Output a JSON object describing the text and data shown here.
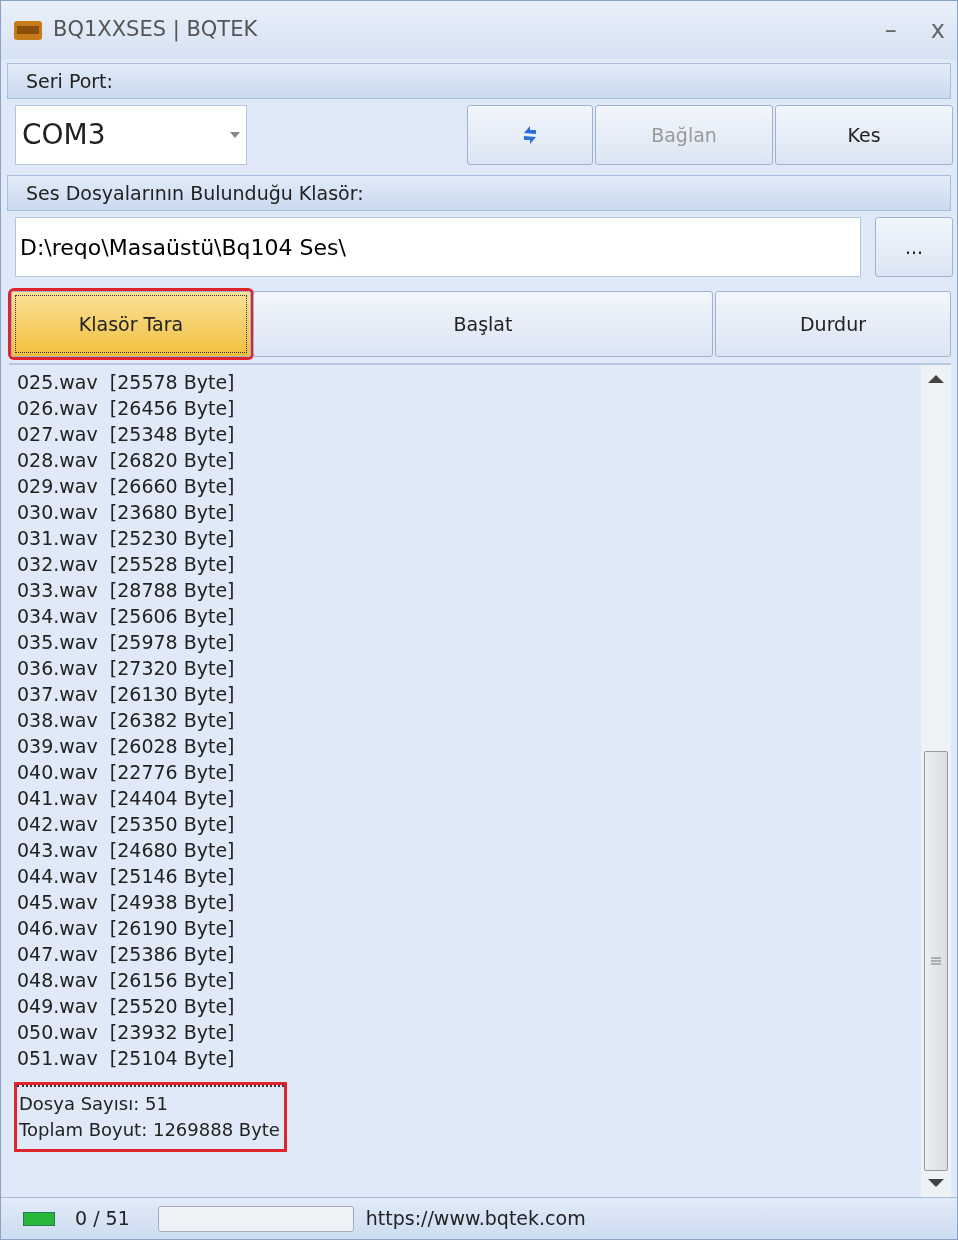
{
  "window": {
    "title": "BQ1XXSES | BQTEK",
    "controls": [
      "–",
      "x"
    ]
  },
  "serial": {
    "header": "Seri Port:",
    "port": "COM3",
    "buttons": [
      {
        "kind": "refresh",
        "disabled": false
      },
      {
        "kind": "text",
        "label": "Bağlan",
        "disabled": true
      },
      {
        "kind": "text",
        "label": "Kes",
        "disabled": false
      }
    ]
  },
  "folder": {
    "header": "Ses Dosyalarının Bulunduğu Klasör:",
    "path": "D:\\reqo\\Masaüstü\\Bq104 Ses\\",
    "browse": "..."
  },
  "actions": [
    {
      "label": "Klasör Tara",
      "focused": true,
      "highlighted": true
    },
    {
      "label": "Başlat",
      "focused": false,
      "highlighted": false
    },
    {
      "label": "Durdur",
      "focused": false,
      "highlighted": false
    }
  ],
  "log": {
    "lines": [
      "025.wav  [25578 Byte]",
      "026.wav  [26456 Byte]",
      "027.wav  [25348 Byte]",
      "028.wav  [26820 Byte]",
      "029.wav  [26660 Byte]",
      "030.wav  [23680 Byte]",
      "031.wav  [25230 Byte]",
      "032.wav  [25528 Byte]",
      "033.wav  [28788 Byte]",
      "034.wav  [25606 Byte]",
      "035.wav  [25978 Byte]",
      "036.wav  [27320 Byte]",
      "037.wav  [26130 Byte]",
      "038.wav  [26382 Byte]",
      "039.wav  [26028 Byte]",
      "040.wav  [22776 Byte]",
      "041.wav  [24404 Byte]",
      "042.wav  [25350 Byte]",
      "043.wav  [24680 Byte]",
      "044.wav  [25146 Byte]",
      "045.wav  [24938 Byte]",
      "046.wav  [26190 Byte]",
      "047.wav  [25386 Byte]",
      "048.wav  [26156 Byte]",
      "049.wav  [25520 Byte]",
      "050.wav  [23932 Byte]",
      "051.wav  [25104 Byte]"
    ],
    "summary": {
      "lines": [
        "Dosya Sayısı: 51",
        "Toplam Boyut: 1269888 Byte"
      ],
      "highlighted": true
    }
  },
  "status_bar": {
    "connected": true,
    "count": "0 / 51",
    "level": 0,
    "url": "https://www.bqtek.com"
  }
}
